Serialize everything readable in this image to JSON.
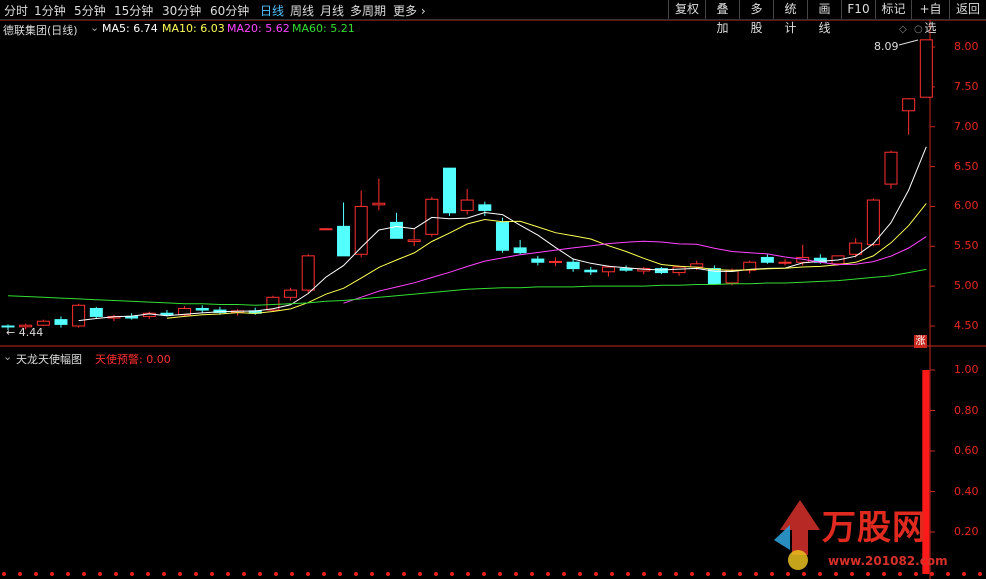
{
  "toolbar": {
    "periods": [
      "分时",
      "1分钟",
      "5分钟",
      "15分钟",
      "30分钟",
      "60分钟",
      "日线",
      "周线",
      "月线",
      "多周期",
      "更多"
    ],
    "active_period": "日线",
    "buttons": [
      "复权",
      "叠加",
      "多股",
      "统计",
      "画线",
      "F10",
      "标记",
      "+自选",
      "返回"
    ]
  },
  "main_chart": {
    "stock_title": "德联集团(日线)",
    "ma": [
      {
        "label": "MA5: 6.74",
        "color": "#ffffff"
      },
      {
        "label": "MA10: 6.03",
        "color": "#ffff55"
      },
      {
        "label": "MA20: 5.62",
        "color": "#ff44ff"
      },
      {
        "label": "MA60: 5.21",
        "color": "#33dd33"
      }
    ],
    "high_marker": "8.09",
    "low_marker": "4.44",
    "limit_up_badge": "涨",
    "y_ticks": [
      "8.00",
      "7.50",
      "7.00",
      "6.50",
      "6.00",
      "5.50",
      "5.00",
      "4.50"
    ]
  },
  "indicator": {
    "title": "天龙天使幅图",
    "signal_label": "天使预警: 0.00",
    "y_ticks": [
      "1.00",
      "0.80",
      "0.60",
      "0.40",
      "0.20"
    ]
  },
  "watermark": {
    "brand": "万股网",
    "url": "www.201082.com"
  },
  "colors": {
    "up": "#ff3030",
    "down": "#54ffff",
    "axis": "#c8281e",
    "bg": "#000000"
  }
}
